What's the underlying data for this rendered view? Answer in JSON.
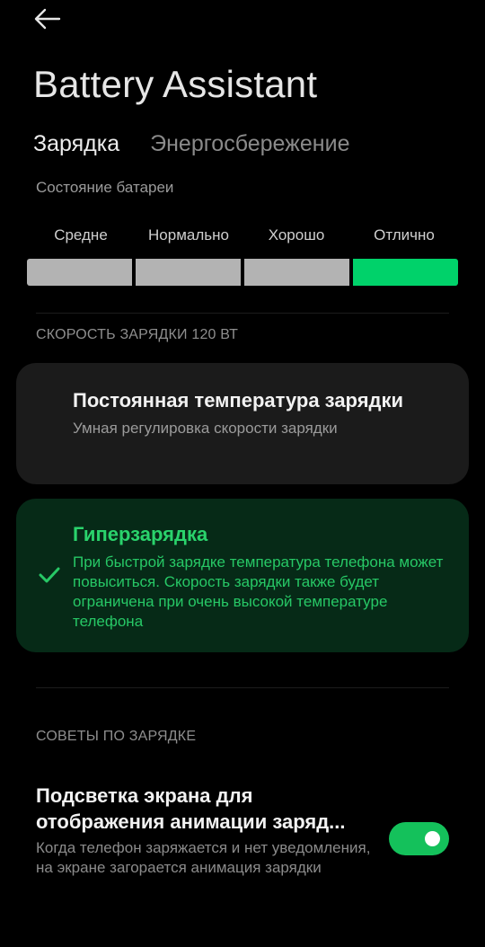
{
  "header": {
    "back_icon": "arrow-left-icon",
    "title": "Battery Assistant"
  },
  "tabs": [
    {
      "label": "Зарядка",
      "active": true
    },
    {
      "label": "Энергосбережение",
      "active": false
    }
  ],
  "battery_state": {
    "label": "Состояние батареи",
    "levels": [
      "Средне",
      "Нормально",
      "Хорошо",
      "Отлично"
    ],
    "current_level_index": 3,
    "inactive_color": "#b3b3b3",
    "active_color": "#00d26a"
  },
  "charging_speed": {
    "heading": "СКОРОСТЬ ЗАРЯДКИ 120 ВТ",
    "options": [
      {
        "title": "Постоянная температура зарядки",
        "description": "Умная регулировка скорости зарядки",
        "selected": false
      },
      {
        "title": "Гиперзарядка",
        "description": "При быстрой зарядке температура телефона может повыситься. Скорость зарядки также будет ограничена при очень высокой температуре телефона",
        "selected": true,
        "icon": "checkmark-icon"
      }
    ]
  },
  "tips": {
    "heading": "СОВЕТЫ ПО ЗАРЯДКЕ",
    "items": [
      {
        "title": "Подсветка экрана для\nотображения анимации заряд...",
        "description": "Когда телефон заряжается и нет уведомления, на экране загорается анимация зарядки",
        "enabled": true
      }
    ]
  },
  "colors": {
    "accent": "#14c15b",
    "selected_card_bg": "#062a17",
    "card_bg": "#1b1b1b",
    "background": "#000000"
  }
}
